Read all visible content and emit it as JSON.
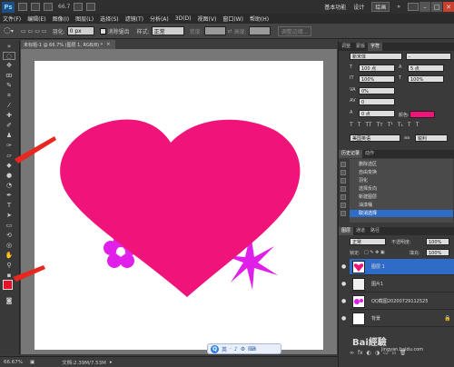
{
  "app": {
    "logo": "Ps",
    "zoom_top": "66.7",
    "workspace": [
      "基本功能",
      "设计"
    ],
    "workspace_active": "绘画",
    "win_min": "–",
    "win_max": "□",
    "win_close": "✕"
  },
  "menu": [
    "文件(F)",
    "编辑(E)",
    "图像(I)",
    "图层(L)",
    "选择(S)",
    "滤镜(T)",
    "分析(A)",
    "3D(D)",
    "视图(V)",
    "窗口(W)",
    "帮助(H)"
  ],
  "options": {
    "feather_label": "羽化:",
    "feather_value": "0 px",
    "antialias": "消除锯齿",
    "style_label": "样式:",
    "style_value": "正常",
    "width_label": "宽度:",
    "height_label": "高度:",
    "refine": "调整边缘..."
  },
  "document": {
    "tab": "未标题-1 @ 66.7% (图层 1, RGB/8) *",
    "zoom": "66.67%",
    "doc_info": "文档:2.39M/7.53M"
  },
  "char_panel": {
    "tabs": [
      "调整",
      "蒙版",
      "字符"
    ],
    "font_family": "新宋体",
    "font_style": "-",
    "font_size": "100 点",
    "leading": "5 点",
    "v_scale": "100%",
    "h_scale": "100%",
    "tracking_a": "0%",
    "tracking_b": "0",
    "baseline": "0 点",
    "color_label": "颜色:",
    "color": "#f0147a",
    "language": "美国英语",
    "aa": "锐利",
    "aa_label": "aa"
  },
  "history": {
    "tabs": [
      "历史记录",
      "动作"
    ],
    "items": [
      "删除选区",
      "自由变换",
      "羽化",
      "选择反向",
      "新建图层",
      "油漆桶",
      "取消选择"
    ]
  },
  "layers": {
    "tabs": [
      "图层",
      "通道",
      "路径"
    ],
    "blend": "正常",
    "opacity_label": "不透明度:",
    "opacity": "100%",
    "lock_label": "锁定:",
    "fill_label": "填充:",
    "fill": "100%",
    "rows": [
      "图层 1",
      "图片1",
      "QQ截图20200729112525",
      "背景"
    ]
  },
  "floatbar": {
    "q": "Q",
    "items": [
      "英",
      "·",
      "♪",
      "⚙",
      "⌨"
    ]
  },
  "watermark": {
    "text": "Bai經驗",
    "url": "jingyan.baidu.com"
  },
  "colors": {
    "heart": "#f0147a",
    "flower": "#e020e8",
    "arrow": "#e8281e",
    "toolbar_fg": "#e8102a"
  }
}
